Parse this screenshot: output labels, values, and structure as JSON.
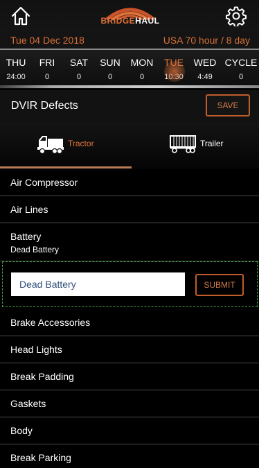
{
  "header": {
    "brand_part1": "BRIDGE",
    "brand_part2": "HAUL",
    "home_icon": "home-icon",
    "settings_icon": "gear-icon",
    "date": "Tue 04 Dec 2018",
    "rule": "USA 70 hour / 8 day"
  },
  "days": [
    {
      "name": "THU",
      "value": "24:00"
    },
    {
      "name": "FRI",
      "value": "0"
    },
    {
      "name": "SAT",
      "value": "0"
    },
    {
      "name": "SUN",
      "value": "0"
    },
    {
      "name": "MON",
      "value": "0"
    },
    {
      "name": "TUE",
      "value": "10:30"
    },
    {
      "name": "WED",
      "value": "4:49"
    },
    {
      "name": "CYCLE",
      "value": "0"
    }
  ],
  "active_day": "TUE",
  "section": {
    "title": "DVIR Defects",
    "save_label": "SAVE"
  },
  "tabs": [
    {
      "label": "Tractor",
      "icon": "truck-icon",
      "active": true
    },
    {
      "label": "Trailer",
      "icon": "trailer-icon",
      "active": false
    }
  ],
  "defects": [
    {
      "label": "Air Compressor"
    },
    {
      "label": "Air Lines"
    },
    {
      "label": "Battery",
      "note": "Dead Battery"
    },
    {
      "label": "Brake Accessories"
    },
    {
      "label": "Head Lights"
    },
    {
      "label": "Break Padding"
    },
    {
      "label": "Gaskets"
    },
    {
      "label": "Body"
    },
    {
      "label": "Break Parking"
    }
  ],
  "editor": {
    "input_value": "Dead Battery",
    "submit_label": "SUBMIT"
  },
  "colors": {
    "accent": "#e0733a",
    "background": "#000000",
    "editor_border": "#3fa33f"
  }
}
